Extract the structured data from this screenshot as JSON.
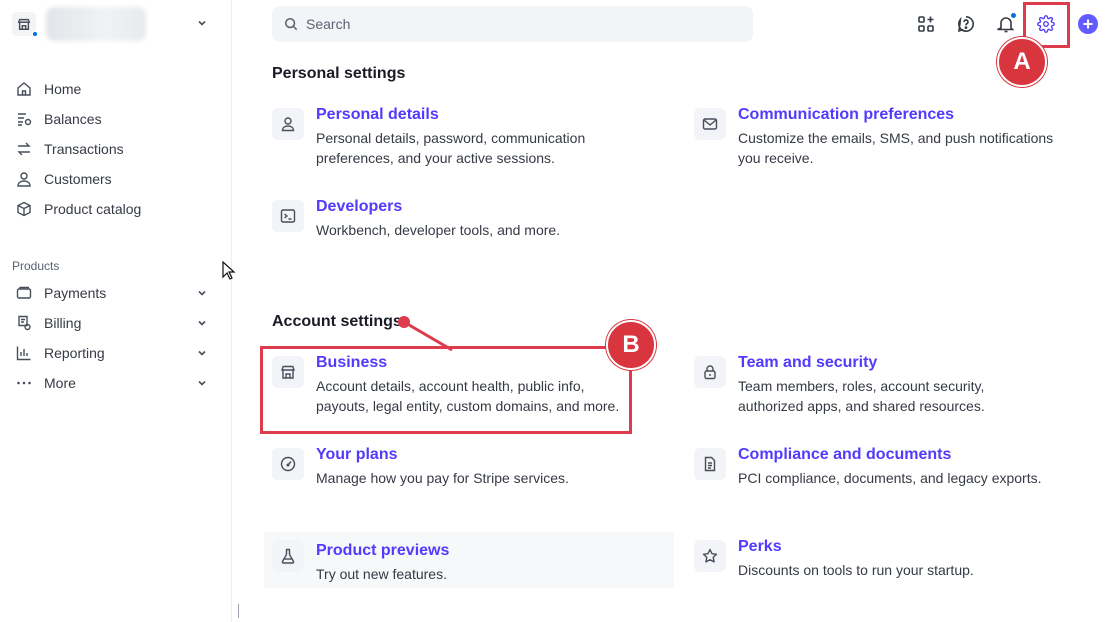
{
  "search": {
    "placeholder": "Search"
  },
  "nav": {
    "items": [
      {
        "label": "Home",
        "icon": "home-icon"
      },
      {
        "label": "Balances",
        "icon": "balances-icon"
      },
      {
        "label": "Transactions",
        "icon": "transactions-icon"
      },
      {
        "label": "Customers",
        "icon": "customers-icon"
      },
      {
        "label": "Product catalog",
        "icon": "product-catalog-icon"
      }
    ],
    "products_title": "Products",
    "products": [
      {
        "label": "Payments",
        "icon": "payments-icon"
      },
      {
        "label": "Billing",
        "icon": "billing-icon"
      },
      {
        "label": "Reporting",
        "icon": "reporting-icon"
      },
      {
        "label": "More",
        "icon": "more-icon"
      }
    ]
  },
  "personal": {
    "heading": "Personal settings",
    "cards": [
      {
        "title": "Personal details",
        "desc": "Personal details, password, communication preferences, and your active sessions."
      },
      {
        "title": "Communication preferences",
        "desc": "Customize the emails, SMS, and push notifications you receive."
      },
      {
        "title": "Developers",
        "desc": "Workbench, developer tools, and more."
      }
    ]
  },
  "account": {
    "heading": "Account settings",
    "cards": [
      {
        "title": "Business",
        "desc": "Account details, account health, public info, payouts, legal entity, custom domains, and more."
      },
      {
        "title": "Team and security",
        "desc": "Team members, roles, account security, authorized apps, and shared resources."
      },
      {
        "title": "Your plans",
        "desc": "Manage how you pay for Stripe services."
      },
      {
        "title": "Compliance and documents",
        "desc": "PCI compliance, documents, and legacy exports."
      },
      {
        "title": "Product previews",
        "desc": "Try out new features."
      },
      {
        "title": "Perks",
        "desc": "Discounts on tools to run your startup."
      }
    ]
  },
  "annotations": {
    "a": "A",
    "b": "B"
  },
  "colors": {
    "accent": "#533afd",
    "annotation": "#d9353f",
    "brand_button": "#635bff"
  }
}
